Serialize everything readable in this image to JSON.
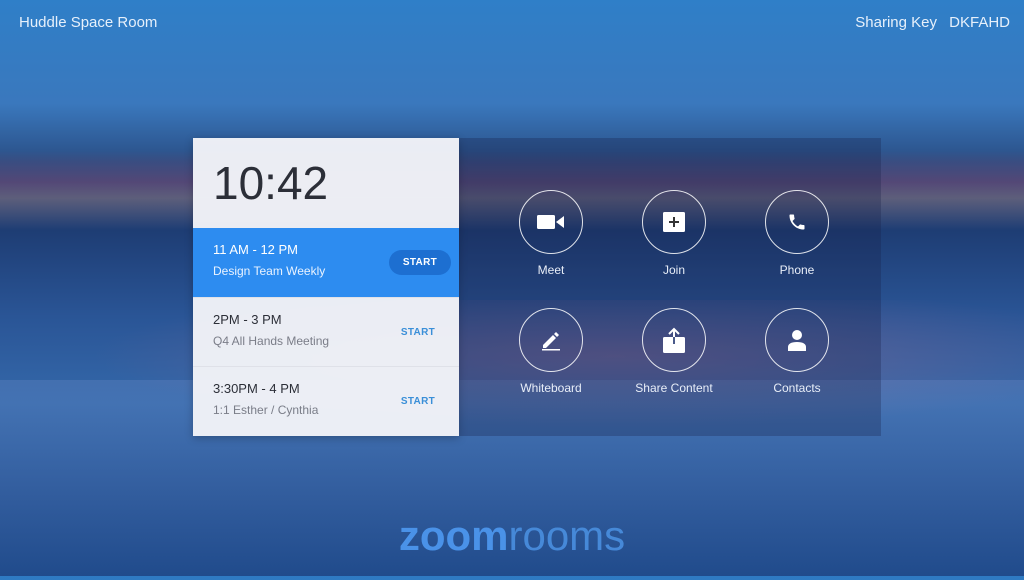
{
  "header": {
    "room_name": "Huddle Space Room",
    "sharing_key_label": "Sharing Key",
    "sharing_key_value": "DKFAHD"
  },
  "schedule": {
    "clock": "10:42",
    "meetings": [
      {
        "time": "11 AM - 12 PM",
        "title": "Design Team Weekly",
        "action": "START",
        "active": true
      },
      {
        "time": "2PM - 3 PM",
        "title": "Q4 All Hands Meeting",
        "action": "START",
        "active": false
      },
      {
        "time": "3:30PM - 4 PM",
        "title": "1:1 Esther / Cynthia",
        "action": "START",
        "active": false
      }
    ]
  },
  "actions": [
    {
      "label": "Meet",
      "icon": "video-camera-icon"
    },
    {
      "label": "Join",
      "icon": "plus-box-icon"
    },
    {
      "label": "Phone",
      "icon": "phone-icon"
    },
    {
      "label": "Whiteboard",
      "icon": "pencil-icon"
    },
    {
      "label": "Share Content",
      "icon": "share-upload-icon"
    },
    {
      "label": "Contacts",
      "icon": "person-icon"
    }
  ],
  "logo": {
    "bold": "zoom",
    "thin": "rooms"
  },
  "colors": {
    "accent": "#2d8cf0",
    "start_button_active": "#1d6fd1",
    "start_text": "#3a8fd8"
  }
}
